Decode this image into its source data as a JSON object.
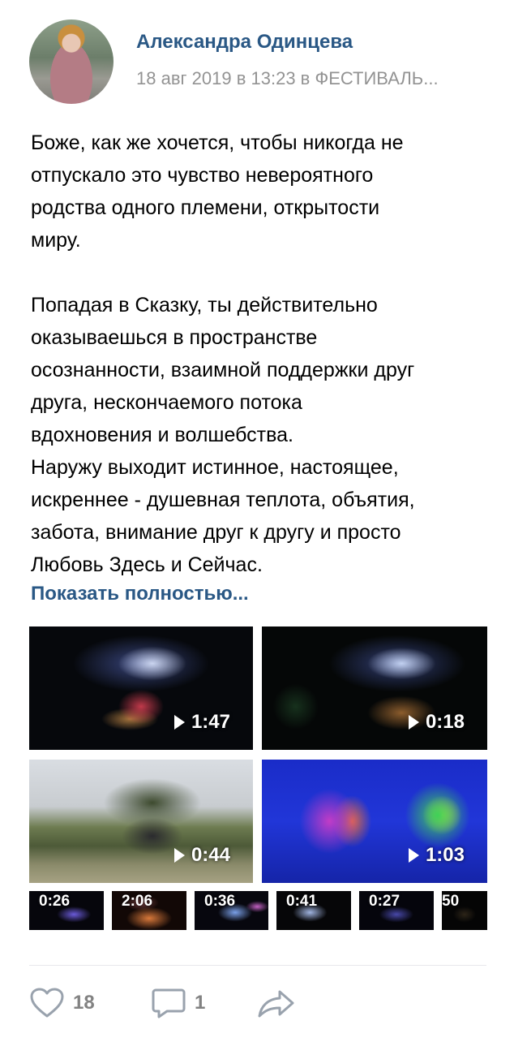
{
  "post": {
    "author": "Александра Одинцева",
    "meta": "18 авг 2019 в 13:23 в ФЕСТИВАЛЬ...",
    "paragraph1": "Боже, как же хочется, чтобы никогда не\nотпускало это чувство невероятного\nродства одного племени, открытости\nмиру.",
    "paragraph2": "Попадая в Сказку, ты действительно\nоказываешься в пространстве\nосознанности, взаимной поддержки друг\nдруга, нескончаемого потока\nвдохновения и волшебства.\nНаружу выходит истинное, настоящее,\nискреннее - душевная теплота, объятия,\nзабота, внимание друг к другу и просто\nЛюбовь Здесь и Сейчас.",
    "show_more": "Показать полностью..."
  },
  "videos": [
    {
      "duration": "1:47"
    },
    {
      "duration": "0:18"
    },
    {
      "duration": "0:44"
    },
    {
      "duration": "1:03"
    }
  ],
  "thumbs": [
    {
      "duration": "0:26"
    },
    {
      "duration": "2:06"
    },
    {
      "duration": "0:36"
    },
    {
      "duration": "0:41"
    },
    {
      "duration": "0:27"
    },
    {
      "duration": "50"
    }
  ],
  "actions": {
    "likes": "18",
    "comments": "1"
  },
  "icons": {
    "like": "heart-icon",
    "comment": "comment-icon",
    "share": "share-icon",
    "play": "play-icon"
  },
  "colors": {
    "link": "#2a5885",
    "meta": "#939393",
    "counter": "#828282",
    "icon": "#99a2ad"
  }
}
